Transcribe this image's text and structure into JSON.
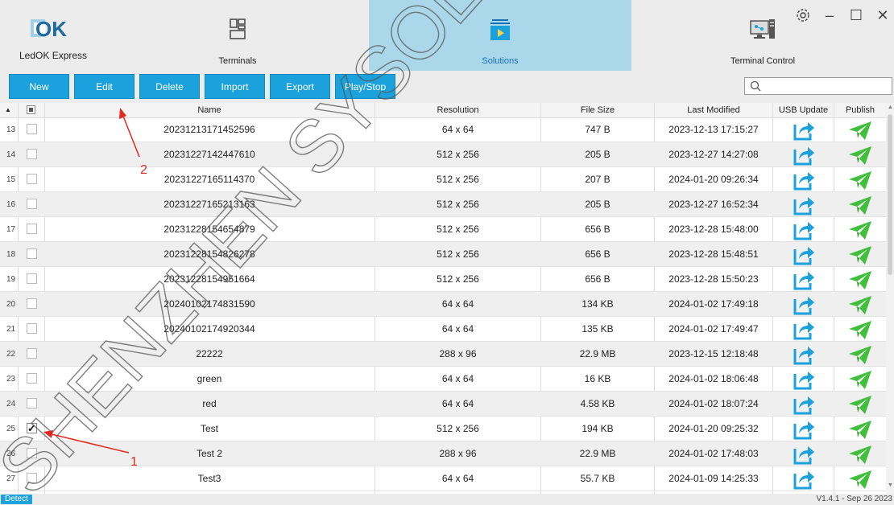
{
  "app": {
    "name": "LedOK Express",
    "logo_text": "OK"
  },
  "tabs": [
    {
      "label": "Terminals"
    },
    {
      "label": "Solutions"
    },
    {
      "label": "Terminal Control"
    }
  ],
  "toolbar": {
    "new_label": "New",
    "edit_label": "Edit",
    "delete_label": "Delete",
    "import_label": "Import",
    "export_label": "Export",
    "playstop_label": "Play/Stop"
  },
  "search": {
    "placeholder": ""
  },
  "table": {
    "columns": [
      "Name",
      "Resolution",
      "File Size",
      "Last Modified",
      "USB Update",
      "Publish"
    ],
    "rows": [
      {
        "num": "13",
        "name": "20231213171452596",
        "resolution": "64 x 64",
        "size": "747 B",
        "modified": "2023-12-13 17:15:27",
        "checked": false
      },
      {
        "num": "14",
        "name": "20231227142447610",
        "resolution": "512 x 256",
        "size": "205 B",
        "modified": "2023-12-27 14:27:08",
        "checked": false
      },
      {
        "num": "15",
        "name": "20231227165114370",
        "resolution": "512 x 256",
        "size": "207 B",
        "modified": "2024-01-20 09:26:34",
        "checked": false
      },
      {
        "num": "16",
        "name": "20231227165213163",
        "resolution": "512 x 256",
        "size": "205 B",
        "modified": "2023-12-27 16:52:34",
        "checked": false
      },
      {
        "num": "17",
        "name": "20231228154654879",
        "resolution": "512 x 256",
        "size": "656 B",
        "modified": "2023-12-28 15:48:00",
        "checked": false
      },
      {
        "num": "18",
        "name": "20231228154826278",
        "resolution": "512 x 256",
        "size": "656 B",
        "modified": "2023-12-28 15:48:51",
        "checked": false
      },
      {
        "num": "19",
        "name": "20231228154951664",
        "resolution": "512 x 256",
        "size": "656 B",
        "modified": "2023-12-28 15:50:23",
        "checked": false
      },
      {
        "num": "20",
        "name": "20240102174831590",
        "resolution": "64 x 64",
        "size": "134 KB",
        "modified": "2024-01-02 17:49:18",
        "checked": false
      },
      {
        "num": "21",
        "name": "20240102174920344",
        "resolution": "64 x 64",
        "size": "135 KB",
        "modified": "2024-01-02 17:49:47",
        "checked": false
      },
      {
        "num": "22",
        "name": "22222",
        "resolution": "288 x 96",
        "size": "22.9 MB",
        "modified": "2023-12-15 12:18:48",
        "checked": false
      },
      {
        "num": "23",
        "name": "green",
        "resolution": "64 x 64",
        "size": "16 KB",
        "modified": "2024-01-02 18:06:48",
        "checked": false
      },
      {
        "num": "24",
        "name": "red",
        "resolution": "64 x 64",
        "size": "4.58 KB",
        "modified": "2024-01-02 18:07:24",
        "checked": false
      },
      {
        "num": "25",
        "name": "Test",
        "resolution": "512 x 256",
        "size": "194 KB",
        "modified": "2024-01-20 09:25:32",
        "checked": true
      },
      {
        "num": "26",
        "name": "Test 2",
        "resolution": "288 x 96",
        "size": "22.9 MB",
        "modified": "2024-01-02 17:48:03",
        "checked": false
      },
      {
        "num": "27",
        "name": "Test3",
        "resolution": "64 x 64",
        "size": "55.7 KB",
        "modified": "2024-01-09 14:25:33",
        "checked": false
      }
    ]
  },
  "status": {
    "detect_label": "Detect",
    "version": "V1.4.1 - Sep 26 2023"
  },
  "annotations": {
    "label_1": "1",
    "label_2": "2"
  },
  "watermark": {
    "text": "SHENZHEN SYSOLUTION"
  },
  "colors": {
    "accent": "#1ba1db",
    "active_tab": "#aad8ea",
    "annotation": "#e3291f",
    "publish_icon": "#3fbf3a"
  }
}
